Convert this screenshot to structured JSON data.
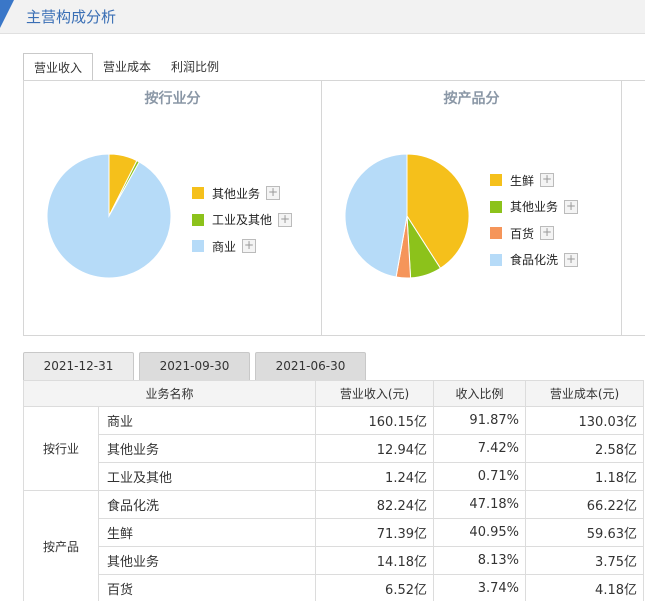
{
  "header": {
    "title": "主营构成分析"
  },
  "tabs": [
    {
      "label": "营业收入",
      "active": true
    },
    {
      "label": "营业成本",
      "active": false
    },
    {
      "label": "利润比例",
      "active": false
    }
  ],
  "colors": {
    "yellow": "#f5c01b",
    "green": "#8cc21b",
    "orange": "#f5955a",
    "light_blue": "#b6dbf8",
    "header_accent": "#3a77c8"
  },
  "chart_data": [
    {
      "type": "pie",
      "title": "按行业分",
      "slices": [
        {
          "name": "其他业务",
          "value": 7.42,
          "color": "#f5c01b"
        },
        {
          "name": "工业及其他",
          "value": 0.71,
          "color": "#8cc21b"
        },
        {
          "name": "商业",
          "value": 91.87,
          "color": "#b6dbf8"
        }
      ]
    },
    {
      "type": "pie",
      "title": "按产品分",
      "slices": [
        {
          "name": "生鲜",
          "value": 40.95,
          "color": "#f5c01b"
        },
        {
          "name": "其他业务",
          "value": 8.13,
          "color": "#8cc21b"
        },
        {
          "name": "百货",
          "value": 3.74,
          "color": "#f5955a"
        },
        {
          "name": "食品化洗",
          "value": 47.18,
          "color": "#b6dbf8"
        }
      ]
    }
  ],
  "date_tabs": [
    {
      "label": "2021-12-31",
      "active": true
    },
    {
      "label": "2021-09-30",
      "active": false
    },
    {
      "label": "2021-06-30",
      "active": false
    }
  ],
  "table": {
    "headers": [
      "业务名称",
      "营业收入(元)",
      "收入比例",
      "营业成本(元)"
    ],
    "groups": [
      {
        "label": "按行业",
        "rows": [
          [
            "商业",
            "160.15亿",
            "91.87%",
            "130.03亿"
          ],
          [
            "其他业务",
            "12.94亿",
            "7.42%",
            "2.58亿"
          ],
          [
            "工业及其他",
            "1.24亿",
            "0.71%",
            "1.18亿"
          ]
        ]
      },
      {
        "label": "按产品",
        "rows": [
          [
            "食品化洗",
            "82.24亿",
            "47.18%",
            "66.22亿"
          ],
          [
            "生鲜",
            "71.39亿",
            "40.95%",
            "59.63亿"
          ],
          [
            "其他业务",
            "14.18亿",
            "8.13%",
            "3.75亿"
          ],
          [
            "百货",
            "6.52亿",
            "3.74%",
            "4.18亿"
          ]
        ]
      }
    ]
  }
}
